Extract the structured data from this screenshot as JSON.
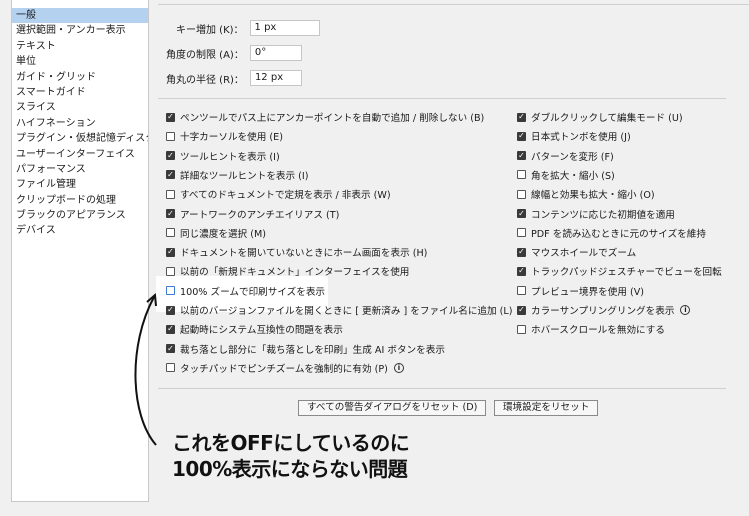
{
  "sidebar": {
    "items": [
      {
        "label": "一般",
        "selected": true
      },
      {
        "label": "選択範囲・アンカー表示"
      },
      {
        "label": "テキスト"
      },
      {
        "label": "単位"
      },
      {
        "label": "ガイド・グリッド"
      },
      {
        "label": "スマートガイド"
      },
      {
        "label": "スライス"
      },
      {
        "label": "ハイフネーション"
      },
      {
        "label": "プラグイン・仮想記憶ディスク"
      },
      {
        "label": "ユーザーインターフェイス"
      },
      {
        "label": "パフォーマンス"
      },
      {
        "label": "ファイル管理"
      },
      {
        "label": "クリップボードの処理"
      },
      {
        "label": "ブラックのアピアランス"
      },
      {
        "label": "デバイス"
      }
    ]
  },
  "fields": {
    "key_increment": {
      "label": "キー増加 (K)：",
      "value": "1 px"
    },
    "constrain_angle": {
      "label": "角度の制限 (A)：",
      "value": "0°"
    },
    "corner_radius": {
      "label": "角丸の半径 (R)：",
      "value": "12 px"
    }
  },
  "left_options": [
    {
      "label": "ペンツールでパス上にアンカーポイントを自動で追加 / 削除しない (B)",
      "checked": true
    },
    {
      "label": "十字カーソルを使用 (E)",
      "checked": false
    },
    {
      "label": "ツールヒントを表示 (I)",
      "checked": true
    },
    {
      "label": "詳細なツールヒントを表示 (I)",
      "checked": true
    },
    {
      "label": "すべてのドキュメントで定規を表示 / 非表示 (W)",
      "checked": false
    },
    {
      "label": "アートワークのアンチエイリアス (T)",
      "checked": true
    },
    {
      "label": "同じ濃度を選択 (M)",
      "checked": false
    },
    {
      "label": "ドキュメントを開いていないときにホーム画面を表示 (H)",
      "checked": true
    },
    {
      "label": "以前の「新規ドキュメント」インターフェイスを使用",
      "checked": false
    },
    {
      "label": "100% ズームで印刷サイズを表示",
      "checked": false,
      "highlight": true
    },
    {
      "label": "以前のバージョンファイルを開くときに [ 更新済み ] をファイル名に追加 (L)",
      "checked": true
    },
    {
      "label": "起動時にシステム互換性の問題を表示",
      "checked": true
    },
    {
      "label": "裁ち落とし部分に「裁ち落としを印刷」生成 AI ボタンを表示",
      "checked": true
    },
    {
      "label": "タッチパッドでピンチズームを強制的に有効 (P)",
      "checked": false,
      "info": true
    }
  ],
  "right_options": [
    {
      "label": "ダブルクリックして編集モード (U)",
      "checked": true
    },
    {
      "label": "日本式トンボを使用 (J)",
      "checked": true
    },
    {
      "label": "パターンを変形 (F)",
      "checked": true
    },
    {
      "label": "角を拡大・縮小 (S)",
      "checked": false
    },
    {
      "label": "線幅と効果も拡大・縮小 (O)",
      "checked": false
    },
    {
      "label": "コンテンツに応じた初期値を適用",
      "checked": true
    },
    {
      "label": "PDF を読み込むときに元のサイズを維持",
      "checked": false
    },
    {
      "label": "マウスホイールでズーム",
      "checked": true
    },
    {
      "label": "トラックパッドジェスチャーでビューを回転",
      "checked": true
    },
    {
      "label": "プレビュー境界を使用 (V)",
      "checked": false
    },
    {
      "label": "カラーサンプリングリングを表示",
      "checked": true,
      "info": true
    },
    {
      "label": "ホバースクロールを無効にする",
      "checked": false
    }
  ],
  "buttons": {
    "reset_warnings": "すべての警告ダイアログをリセット (D)",
    "reset_prefs": "環境設定をリセット"
  },
  "annotation": {
    "line1": "これをOFFにしているのに",
    "line2": "100%表示にならない問題"
  },
  "info_glyph": "i",
  "colors": {
    "selection": "#b4d2f0",
    "checkbox_on": "#3a3a3a",
    "highlight_border": "#3c7ad6"
  }
}
